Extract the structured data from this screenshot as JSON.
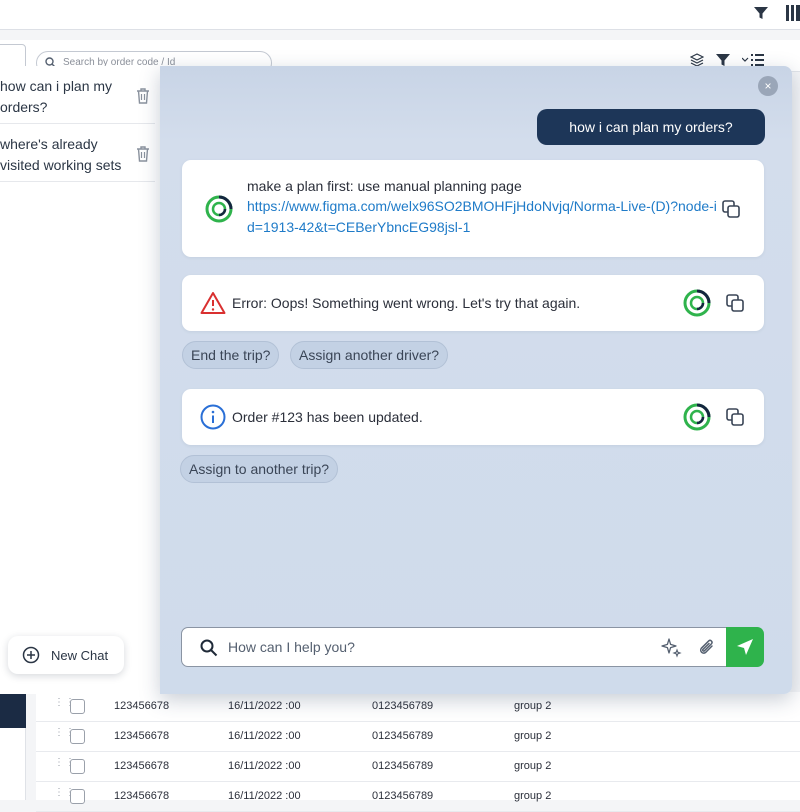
{
  "background": {
    "search_placeholder": "Search by order code / Id",
    "table_rows": [
      {
        "id": "123456678",
        "date": "16/11/2022 :00",
        "code": "0123456789",
        "group": "group 2"
      },
      {
        "id": "123456678",
        "date": "16/11/2022 :00",
        "code": "0123456789",
        "group": "group 2"
      },
      {
        "id": "123456678",
        "date": "16/11/2022 :00",
        "code": "0123456789",
        "group": "group 2"
      },
      {
        "id": "123456678",
        "date": "16/11/2022 :00",
        "code": "0123456789",
        "group": "group 2"
      }
    ]
  },
  "history": {
    "items": [
      {
        "label": "how can i plan my orders?"
      },
      {
        "label": "where's already visited working sets"
      }
    ],
    "new_chat_label": "New Chat"
  },
  "chat": {
    "close_icon": "×",
    "user_message": "how i can plan my orders?",
    "bot_message_1": {
      "text": "make a plan first: use manual planning page",
      "link": "https://www.figma.com/welx96SO2BMOHFjHdoNvjq/Norma-Live-(D)?node-id=1913-42&t=CEBerYbncEG98jsl-1"
    },
    "error_message": "Error: Oops! Something went wrong. Let's try that again.",
    "error_suggestions": [
      "End the trip?",
      "Assign another driver?"
    ],
    "info_message": "Order #123 has been updated.",
    "info_suggestions": [
      "Assign to another trip?"
    ],
    "input_placeholder": "How can I help you?"
  },
  "colors": {
    "accent_green": "#2fb34c",
    "user_bubble": "#1d3658",
    "link": "#1f7bc8",
    "error": "#d93030",
    "info": "#2a6fd6"
  }
}
